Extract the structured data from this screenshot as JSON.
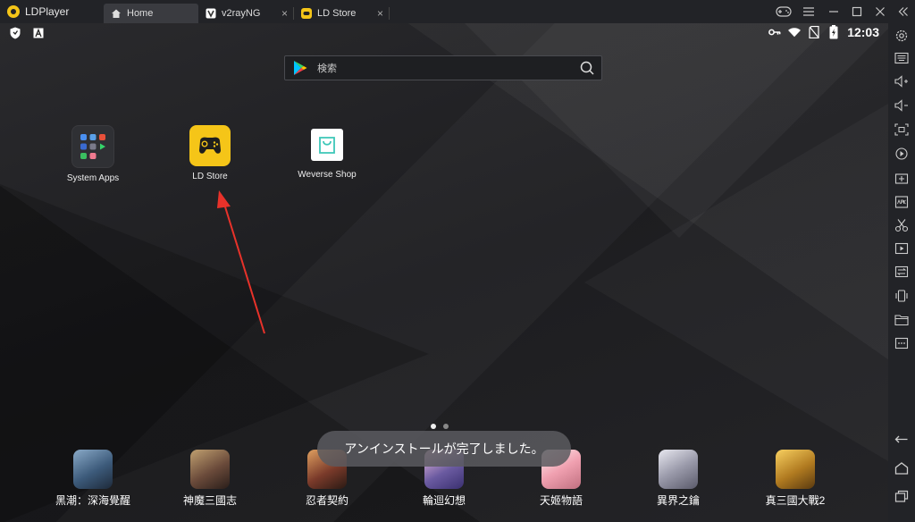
{
  "app": {
    "name": "LDPlayer"
  },
  "tabs": [
    {
      "label": "Home",
      "icon": "home-icon",
      "active": true
    },
    {
      "label": "v2rayNG",
      "icon": "v2rayng-icon",
      "active": false
    },
    {
      "label": "LD Store",
      "icon": "ld-store-icon",
      "active": false
    }
  ],
  "status": {
    "time": "12:03"
  },
  "search": {
    "placeholder": "検索"
  },
  "desktop": [
    {
      "label": "System Apps",
      "icon": "system-apps-folder-icon"
    },
    {
      "label": "LD Store",
      "icon": "ld-store-app-icon"
    },
    {
      "label": "Weverse Shop",
      "icon": "weverse-shop-icon"
    }
  ],
  "dock": [
    {
      "label": "黑潮：深海覺醒",
      "color": "#3c5a7a"
    },
    {
      "label": "神魔三國志",
      "color": "#6a4a3a"
    },
    {
      "label": "忍者契約",
      "color": "#7a3a2a"
    },
    {
      "label": "輪迴幻想",
      "color": "#6a5aa0"
    },
    {
      "label": "天姬物語",
      "color": "#c07080"
    },
    {
      "label": "異界之鑰",
      "color": "#5a5a6a"
    },
    {
      "label": "真三國大戰2",
      "color": "#b07a20"
    }
  ],
  "toast": {
    "message": "アンインストールが完了しました。"
  },
  "colors": {
    "accent": "#f5c518",
    "arrow": "#e8322a"
  }
}
